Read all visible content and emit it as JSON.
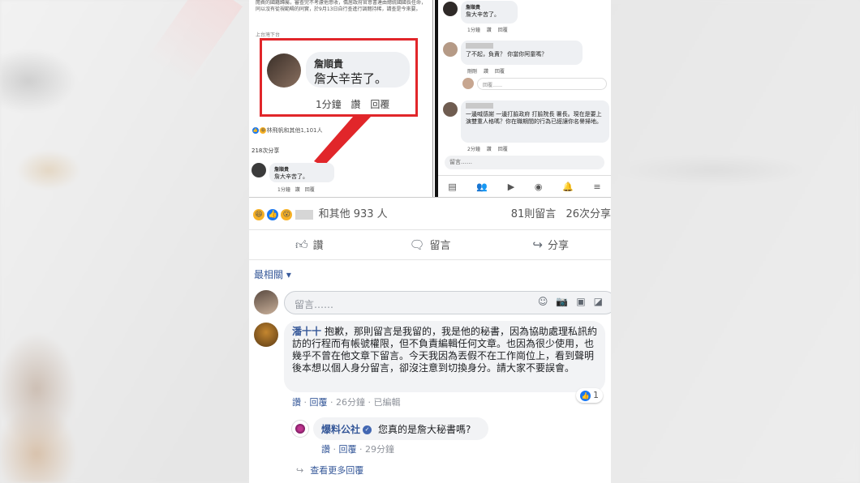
{
  "shot": {
    "left": {
      "article_text": "閱費的國籍歸屬，審查完不考慮他意收，僑居政府官意書達由總統國國長任命，同以沒有從視範疇的同實，於9月13日自行查進行調閱持稀，請查是今來要。",
      "meta": "上台灣下台",
      "highlight": {
        "name": "詹順貴",
        "text": "詹大辛苦了。",
        "time": "1分鐘",
        "like": "讚",
        "reply": "回覆"
      },
      "reactions": "林飛帆和其他1,101人",
      "shares": "218次分享",
      "mini": {
        "name": "詹順貴",
        "text": "詹大辛苦了。",
        "time": "1分鐘",
        "like": "讚",
        "reply": "回覆"
      }
    },
    "right": {
      "c1": {
        "name": "詹順貴",
        "text": "詹大辛苦了。",
        "time": "1分鐘",
        "like": "讚",
        "reply": "回覆"
      },
      "c2": {
        "text": "了不起，負責？ 你當你阿童嗎？",
        "time": "剛剛",
        "like": "讚",
        "reply": "回覆"
      },
      "c3": {
        "text": "回覆……"
      },
      "c4": {
        "text": "一邊喊感謝 一邊打臉政府 打臉院長 署長。現在是要上演雙重人格嗎？你在職期間的行為已經讓你名譽掃地。",
        "time": "2分鐘",
        "like": "讚",
        "reply": "回覆"
      },
      "input_placeholder": "留言……"
    }
  },
  "stats": {
    "reactions_suffix": "和其他 933 人",
    "comments": "81則留言",
    "shares": "26次分享"
  },
  "actions": {
    "like": "讚",
    "comment": "留言",
    "share": "分享"
  },
  "sort": "最相關 ▾",
  "compose": {
    "placeholder": "留言……"
  },
  "comment": {
    "name": "潘十十",
    "text": "抱歉，那則留言是我留的，我是他的秘書，因為協助處理私訊約訪的行程而有帳號權限，但不負責編輯任何文章。也因為很少使用，也幾乎不曾在他文章下留言。今天我因為丟假不在工作崗位上，看到聲明後本想以個人身分留言，卻沒注意到切換身分。請大家不要誤會。",
    "like": "讚",
    "reply": "回覆",
    "time": "26分鐘",
    "edited": "已編輯",
    "like_count": "1"
  },
  "reply": {
    "name": "爆料公社",
    "text": "您真的是詹大秘書嗎?",
    "like": "讚",
    "reply": "回覆",
    "time": "29分鐘"
  },
  "more_replies": "查看更多回覆",
  "colors": {
    "link": "#365899",
    "highlight_border": "#e1262a",
    "bubble": "#f2f3f5"
  }
}
